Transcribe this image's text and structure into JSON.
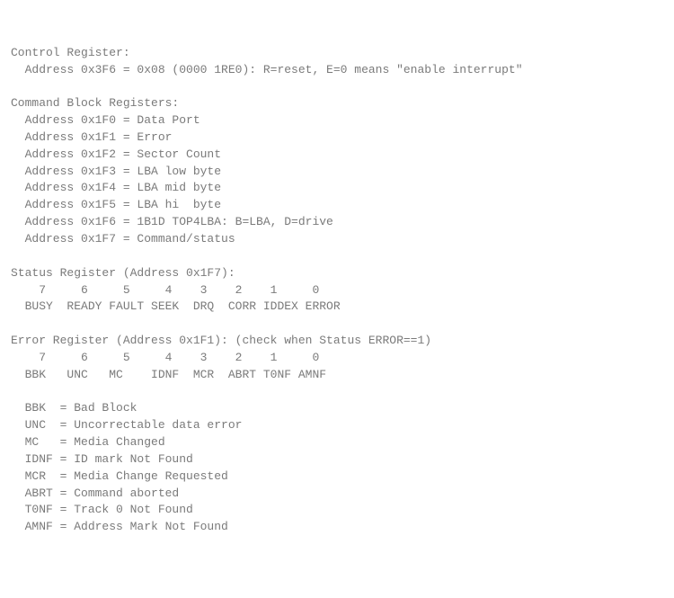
{
  "lines": [
    "Control Register:",
    "  Address 0x3F6 = 0x08 (0000 1RE0): R=reset, E=0 means \"enable interrupt\"",
    "",
    "Command Block Registers:",
    "  Address 0x1F0 = Data Port",
    "  Address 0x1F1 = Error",
    "  Address 0x1F2 = Sector Count",
    "  Address 0x1F3 = LBA low byte",
    "  Address 0x1F4 = LBA mid byte",
    "  Address 0x1F5 = LBA hi  byte",
    "  Address 0x1F6 = 1B1D TOP4LBA: B=LBA, D=drive",
    "  Address 0x1F7 = Command/status",
    "",
    "Status Register (Address 0x1F7):",
    "    7     6     5     4    3    2    1     0",
    "  BUSY  READY FAULT SEEK  DRQ  CORR IDDEX ERROR",
    "",
    "Error Register (Address 0x1F1): (check when Status ERROR==1)",
    "    7     6     5     4    3    2    1     0",
    "  BBK   UNC   MC    IDNF  MCR  ABRT T0NF AMNF",
    "",
    "  BBK  = Bad Block",
    "  UNC  = Uncorrectable data error",
    "  MC   = Media Changed",
    "  IDNF = ID mark Not Found",
    "  MCR  = Media Change Requested",
    "  ABRT = Command aborted",
    "  T0NF = Track 0 Not Found",
    "  AMNF = Address Mark Not Found"
  ]
}
